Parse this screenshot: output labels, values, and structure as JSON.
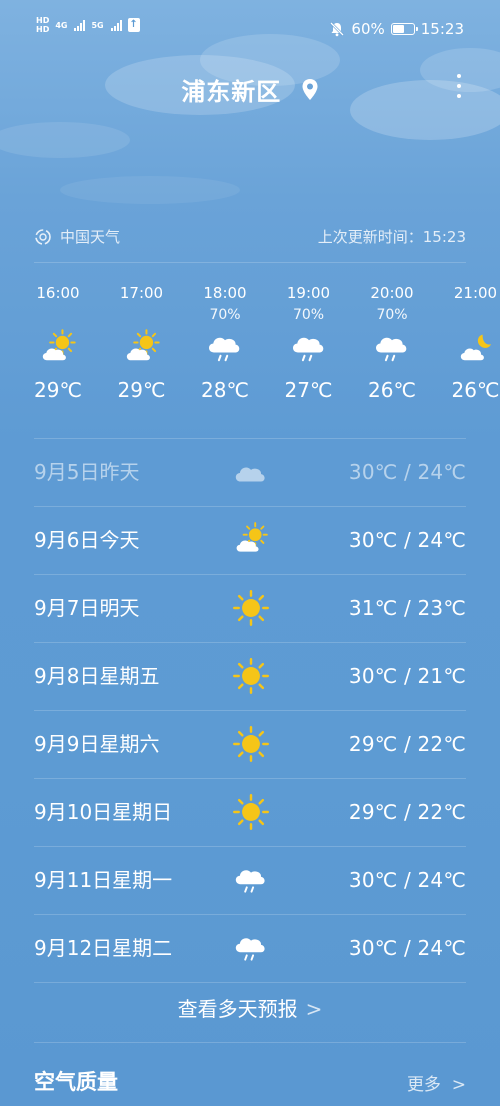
{
  "status_bar": {
    "hd_1": "HD",
    "hd_2": "HD",
    "net_1": "4G",
    "net_2": "5G",
    "battery": "60%",
    "battery_level": 0.6,
    "time": "15:23"
  },
  "header": {
    "city": "浦东新区"
  },
  "source": {
    "name": "中国天气",
    "update": "上次更新时间：15:23"
  },
  "hourly": [
    {
      "time": "16:00",
      "prob": "",
      "icon": "partly-cloudy-icon",
      "temp": "29℃"
    },
    {
      "time": "17:00",
      "prob": "",
      "icon": "partly-cloudy-icon",
      "temp": "29℃"
    },
    {
      "time": "18:00",
      "prob": "70%",
      "icon": "light-rain-icon",
      "temp": "28℃"
    },
    {
      "time": "19:00",
      "prob": "70%",
      "icon": "light-rain-icon",
      "temp": "27℃"
    },
    {
      "time": "20:00",
      "prob": "70%",
      "icon": "light-rain-icon",
      "temp": "26℃"
    },
    {
      "time": "21:00",
      "prob": "",
      "icon": "cloudy-night-icon",
      "temp": "26℃"
    }
  ],
  "daily": [
    {
      "label": "9月5日昨天",
      "icon": "cloudy-icon",
      "range": "30℃ / 24℃",
      "past": true
    },
    {
      "label": "9月6日今天",
      "icon": "partly-cloudy-icon",
      "range": "30℃ / 24℃"
    },
    {
      "label": "9月7日明天",
      "icon": "sunny-icon",
      "range": "31℃ / 23℃"
    },
    {
      "label": "9月8日星期五",
      "icon": "sunny-icon",
      "range": "30℃ / 21℃"
    },
    {
      "label": "9月9日星期六",
      "icon": "sunny-icon",
      "range": "29℃ / 22℃"
    },
    {
      "label": "9月10日星期日",
      "icon": "sunny-icon",
      "range": "29℃ / 22℃"
    },
    {
      "label": "9月11日星期一",
      "icon": "light-rain-icon",
      "range": "30℃ / 24℃"
    },
    {
      "label": "9月12日星期二",
      "icon": "light-rain-icon",
      "range": "30℃ / 24℃"
    }
  ],
  "forecast_link": "查看多天预报",
  "air_quality": {
    "title": "空气质量",
    "more": "更多"
  },
  "colors": {
    "background": "#5d9bd3",
    "sun": "#f5c518"
  }
}
